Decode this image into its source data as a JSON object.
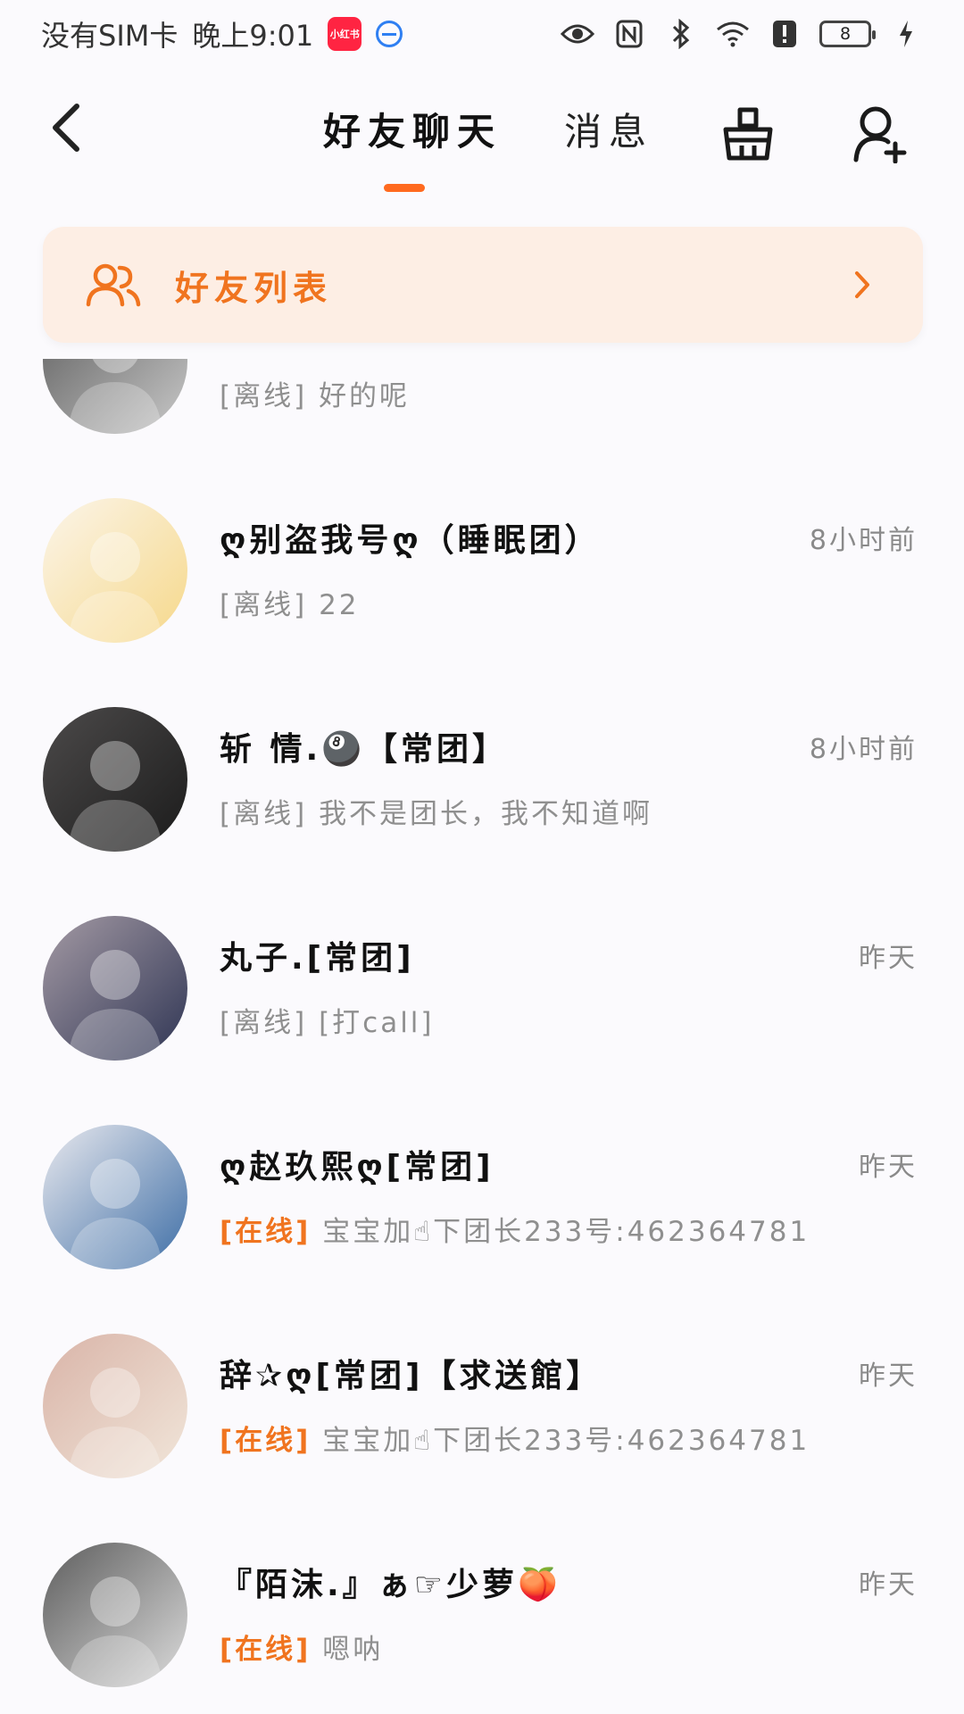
{
  "status_bar": {
    "carrier": "没有SIM卡",
    "time": "晚上9:01",
    "app_badge": "小红书",
    "battery": "8"
  },
  "header": {
    "tabs": [
      {
        "label": "好友聊天",
        "active": true
      },
      {
        "label": "消息",
        "active": false
      }
    ],
    "accent_color": "#ff6a1f"
  },
  "friends_banner": {
    "label": "好友列表",
    "icon": "friends-icon"
  },
  "chat_list": [
    {
      "name": "",
      "time": "",
      "status": "[离线]",
      "status_type": "offline",
      "message": "好的呢",
      "avatar_colors": [
        "#5a5a5a",
        "#c9c9c9"
      ]
    },
    {
      "name": "ღ别盗我号ღ（睡眠团）",
      "time": "8小时前",
      "status": "[离线]",
      "status_type": "offline",
      "message": "22",
      "avatar_colors": [
        "#fbf5ea",
        "#f6d88a"
      ]
    },
    {
      "name": "斩 情.🎱【常团】",
      "time": "8小时前",
      "status": "[离线]",
      "status_type": "offline",
      "message": "我不是团长，我不知道啊",
      "avatar_colors": [
        "#4c4a4a",
        "#1b1b1b"
      ]
    },
    {
      "name": "丸子.[常团]",
      "time": "昨天",
      "status": "[离线]",
      "status_type": "offline",
      "message": "[打call]",
      "avatar_colors": [
        "#a49aa4",
        "#2f3554"
      ]
    },
    {
      "name": "ღ赵玖熙ღ[常团]",
      "time": "昨天",
      "status": "[在线]",
      "status_type": "online",
      "message": "宝宝加☝下团长233号:462364781",
      "avatar_colors": [
        "#e9e9ee",
        "#3e6ea6"
      ]
    },
    {
      "name": "辞✰ღ[常团]【求送館】",
      "time": "昨天",
      "status": "[在线]",
      "status_type": "online",
      "message": "宝宝加☝下团长233号:462364781",
      "avatar_colors": [
        "#d9b4a8",
        "#f1e6da"
      ]
    },
    {
      "name": "『陌沫.』ぁ☞少萝🍑",
      "time": "昨天",
      "status": "[在线]",
      "status_type": "online",
      "message": "嗯呐",
      "avatar_colors": [
        "#5d5d5d",
        "#dcdcdc"
      ]
    }
  ]
}
